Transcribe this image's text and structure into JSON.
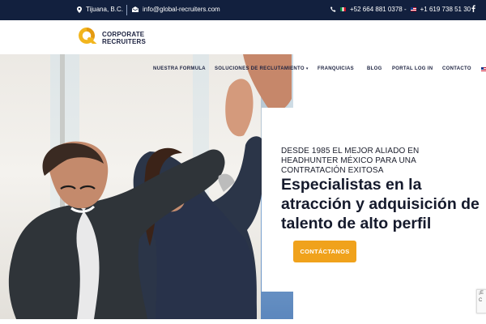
{
  "topbar": {
    "location": "Tijuana, B.C.",
    "email": "info@global-recruiters.com",
    "phones": "+52 664 881 0378 - ",
    "phone_us": "+1 619 738 51 30"
  },
  "logo": {
    "line1": "CORPORATE",
    "line2": "RECRUITERS"
  },
  "nav": {
    "items": [
      {
        "label": "NUESTRA FORMULA"
      },
      {
        "label": "SOLUCIONES DE RECLUTAMIENTO"
      },
      {
        "label": "FRANQUICIAS"
      },
      {
        "label": "BLOG"
      },
      {
        "label": "PORTAL LOG IN"
      },
      {
        "label": "CONTACTO"
      }
    ]
  },
  "hero": {
    "eyebrow": "DESDE 1985 EL MEJOR ALIADO EN HEADHUNTER MÉXICO PARA UNA CONTRATACIÓN EXITOSA",
    "headline": "Especialistas en la atracción y adquisición de talento de alto perfil",
    "cta_label": "CONTÁCTANOS"
  },
  "recaptcha": {
    "text": "¡E C"
  },
  "colors": {
    "topbar_bg": "#12203e",
    "cta": "#f0a21c",
    "text_dark": "#151a2c",
    "logo_accent": "#f2b51d"
  }
}
